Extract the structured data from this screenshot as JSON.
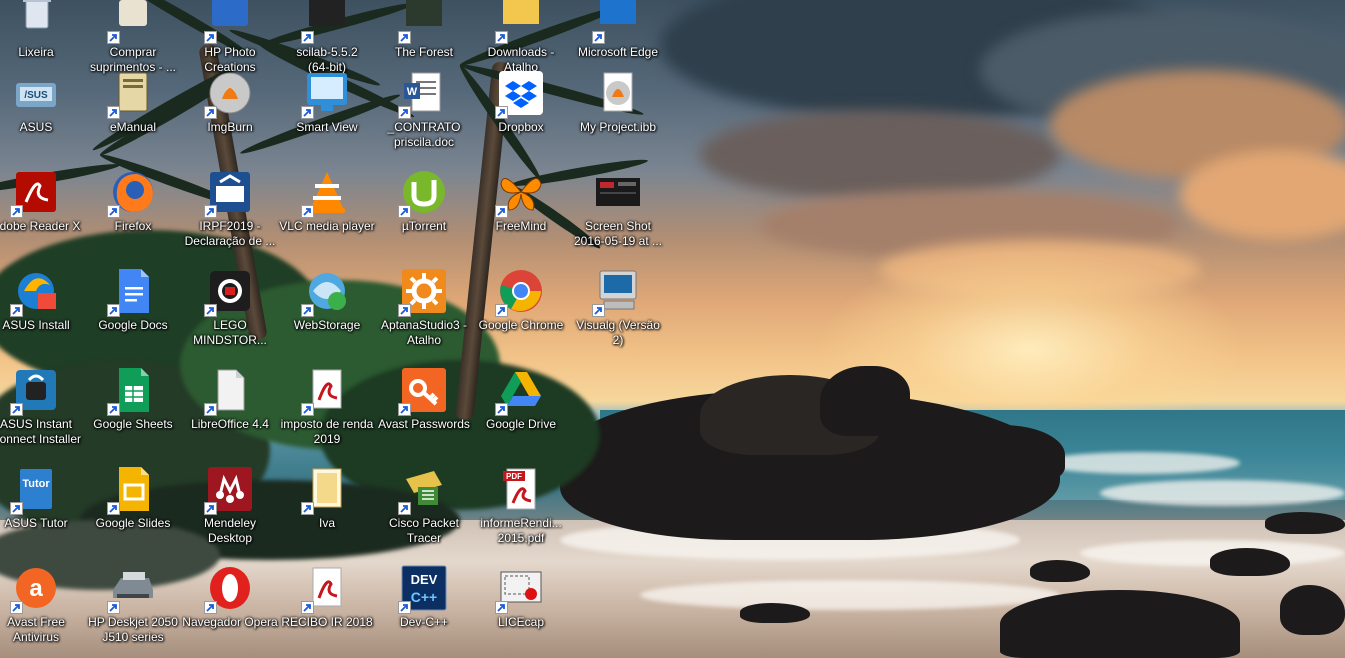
{
  "desktop": {
    "rows": [
      {
        "cells": [
          {
            "l1": "Lixeira",
            "l2": ""
          },
          {
            "l1": "Comprar",
            "l2": "suprimentos - ..."
          },
          {
            "l1": "HP Photo",
            "l2": "Creations"
          },
          {
            "l1": "scilab-5.5.2",
            "l2": "(64-bit)"
          },
          {
            "l1": "The Forest",
            "l2": ""
          },
          {
            "l1": "Downloads -",
            "l2": "Atalho"
          },
          {
            "l1": "Microsoft Edge",
            "l2": ""
          }
        ]
      },
      {
        "cells": [
          {
            "l1": "ASUS",
            "l2": ""
          },
          {
            "l1": "eManual",
            "l2": ""
          },
          {
            "l1": "ImgBurn",
            "l2": ""
          },
          {
            "l1": "Smart View",
            "l2": ""
          },
          {
            "l1": "_CONTRATO",
            "l2": "priscila.doc"
          },
          {
            "l1": "Dropbox",
            "l2": ""
          },
          {
            "l1": "My Project.ibb",
            "l2": ""
          }
        ]
      },
      {
        "cells": [
          {
            "l1": "Adobe Reader X",
            "l2": ""
          },
          {
            "l1": "Firefox",
            "l2": ""
          },
          {
            "l1": "IRPF2019 -",
            "l2": "Declaração de ..."
          },
          {
            "l1": "VLC media player",
            "l2": ""
          },
          {
            "l1": "µTorrent",
            "l2": ""
          },
          {
            "l1": "FreeMind",
            "l2": ""
          },
          {
            "l1": "Screen Shot",
            "l2": "2016-05-19 at ..."
          }
        ]
      },
      {
        "cells": [
          {
            "l1": "ASUS Install",
            "l2": ""
          },
          {
            "l1": "Google Docs",
            "l2": ""
          },
          {
            "l1": "LEGO",
            "l2": "MINDSTOR..."
          },
          {
            "l1": "WebStorage",
            "l2": ""
          },
          {
            "l1": "AptanaStudio3 -",
            "l2": "Atalho"
          },
          {
            "l1": "Google Chrome",
            "l2": ""
          },
          {
            "l1": "Visualg (Versão 2)",
            "l2": ""
          }
        ]
      },
      {
        "cells": [
          {
            "l1": "ASUS Instant",
            "l2": "Connect Installer"
          },
          {
            "l1": "Google Sheets",
            "l2": ""
          },
          {
            "l1": "LibreOffice 4.4",
            "l2": ""
          },
          {
            "l1": "imposto de renda",
            "l2": "2019"
          },
          {
            "l1": "Avast Passwords",
            "l2": ""
          },
          {
            "l1": "Google Drive",
            "l2": ""
          }
        ]
      },
      {
        "cells": [
          {
            "l1": "ASUS Tutor",
            "l2": ""
          },
          {
            "l1": "Google Slides",
            "l2": ""
          },
          {
            "l1": "Mendeley",
            "l2": "Desktop"
          },
          {
            "l1": "Iva",
            "l2": ""
          },
          {
            "l1": "Cisco Packet",
            "l2": "Tracer"
          },
          {
            "l1": "informeRendi...",
            "l2": "2015.pdf"
          }
        ]
      },
      {
        "cells": [
          {
            "l1": "Avast Free",
            "l2": "Antivirus"
          },
          {
            "l1": "HP Deskjet 2050",
            "l2": "J510 series"
          },
          {
            "l1": "Navegador Opera",
            "l2": ""
          },
          {
            "l1": "RECIBO IR 2018",
            "l2": ""
          },
          {
            "l1": "Dev-C++",
            "l2": ""
          },
          {
            "l1": "LICEcap",
            "l2": ""
          }
        ]
      }
    ]
  }
}
